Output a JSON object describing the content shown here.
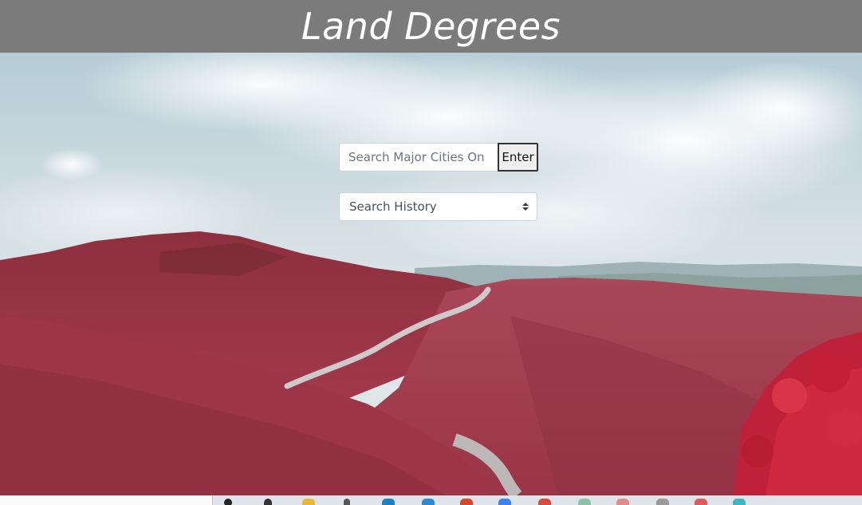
{
  "header": {
    "title": "Land Degrees"
  },
  "search": {
    "placeholder": "Search Major Cities On",
    "enter_label": "Enter"
  },
  "history": {
    "selected": "Search History"
  },
  "taskbar": {
    "icons": [
      "search-icon",
      "task-view-icon",
      "file-explorer-icon",
      "pin-icon",
      "edge-icon",
      "vscode-icon",
      "office-icon",
      "mail-icon",
      "chrome-icon",
      "slack-icon",
      "feather-icon",
      "app-icon",
      "app-icon",
      "app-icon"
    ]
  },
  "colors": {
    "header_bg": "#7b7b7b",
    "header_text": "#ffffff",
    "foliage": "#a63a4e"
  }
}
